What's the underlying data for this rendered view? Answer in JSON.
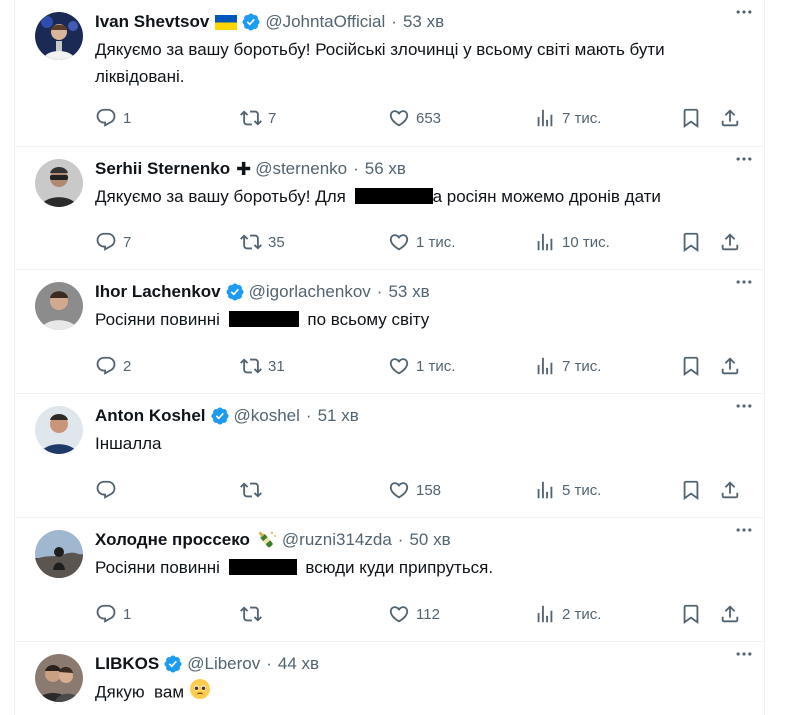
{
  "colors": {
    "text": "#0f1419",
    "muted": "#536471",
    "verified": "#1d9bf0",
    "divider": "#eff3f4"
  },
  "tweets": [
    {
      "name": "Ivan Shevtsov",
      "handle": "@JohntaOfficial",
      "time": "53 хв",
      "flag": "ukraine-flag",
      "verified": true,
      "text_lines": [
        "Дякуємо за вашу боротьбу! Російські злочинці у всьому світі мають бути",
        "ліквідовані."
      ],
      "replies": "1",
      "reposts": "7",
      "likes": "653",
      "views": "7 тис."
    },
    {
      "name": "Serhii Sternenko",
      "handle": "@sternenko",
      "time": "56 хв",
      "cross": "✚",
      "text_before": "Дякуємо за вашу боротьбу! Для",
      "text_after": "а росіян можемо дронів дати",
      "replies": "7",
      "reposts": "35",
      "likes": "1 тис.",
      "views": "10 тис."
    },
    {
      "name": "Ihor Lachenkov",
      "handle": "@igorlachenkov",
      "time": "53 хв",
      "verified": true,
      "text_before": "Росіяни повинні",
      "text_after": "по всьому світу",
      "replies": "2",
      "reposts": "31",
      "likes": "1 тис.",
      "views": "7 тис."
    },
    {
      "name": "Anton Koshel",
      "handle": "@koshel",
      "time": "51 хв",
      "verified": true,
      "text": "Іншалла",
      "replies": "",
      "reposts": "",
      "likes": "158",
      "views": "5 тис."
    },
    {
      "name": "Холодне проссеко",
      "handle": "@ruzni314zda",
      "time": "50 хв",
      "emoji": "champagne-bottle",
      "text_before": "Росіяни повинні",
      "text_after": "всюди куди припруться.",
      "replies": "1",
      "reposts": "",
      "likes": "112",
      "views": "2 тис."
    },
    {
      "name": "LIBKOS",
      "handle": "@Liberov",
      "time": "44 хв",
      "verified": true,
      "text": "Дякую  вам",
      "emoji": "pleading-face"
    }
  ],
  "icons": {
    "reply": "reply-icon",
    "repost": "repost-icon",
    "like": "heart-icon",
    "views": "views-icon",
    "bookmark": "bookmark-icon",
    "share": "share-icon",
    "more": "more-icon",
    "verified": "verified-badge-icon"
  }
}
